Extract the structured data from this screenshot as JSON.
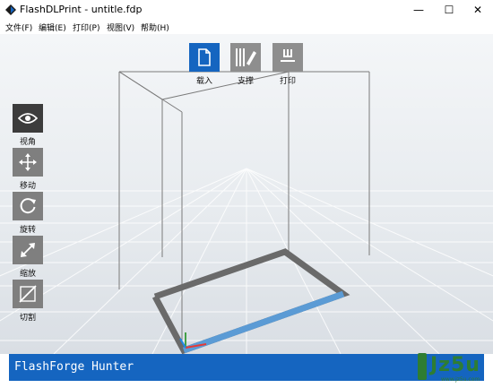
{
  "window": {
    "title": "FlashDLPrint - untitle.fdp",
    "min_glyph": "—",
    "max_glyph": "☐",
    "close_glyph": "✕"
  },
  "menu": {
    "items": [
      "文件(F)",
      "编辑(E)",
      "打印(P)",
      "视图(V)",
      "帮助(H)"
    ]
  },
  "top_toolbar": {
    "load_label": "载入",
    "support_label": "支撑",
    "print_label": "打印",
    "load_icon": "file-icon",
    "support_icon": "support-pencil-icon",
    "print_icon": "print-download-icon"
  },
  "side_toolbar": {
    "view_label": "视角",
    "move_label": "移动",
    "rotate_label": "旋转",
    "scale_label": "缩放",
    "cut_label": "切割"
  },
  "status": {
    "printer_name": "FlashForge Hunter"
  },
  "watermark": {
    "text": "Jz5u",
    "sub": "www.jz5u.com"
  },
  "colors": {
    "accent": "#1565c0",
    "active_tool": "#3c3c3c",
    "inactive_tool": "#7f7f7f",
    "axis_x": "#e53935",
    "axis_y": "#43a047",
    "axis_z": "#1e88e5"
  }
}
